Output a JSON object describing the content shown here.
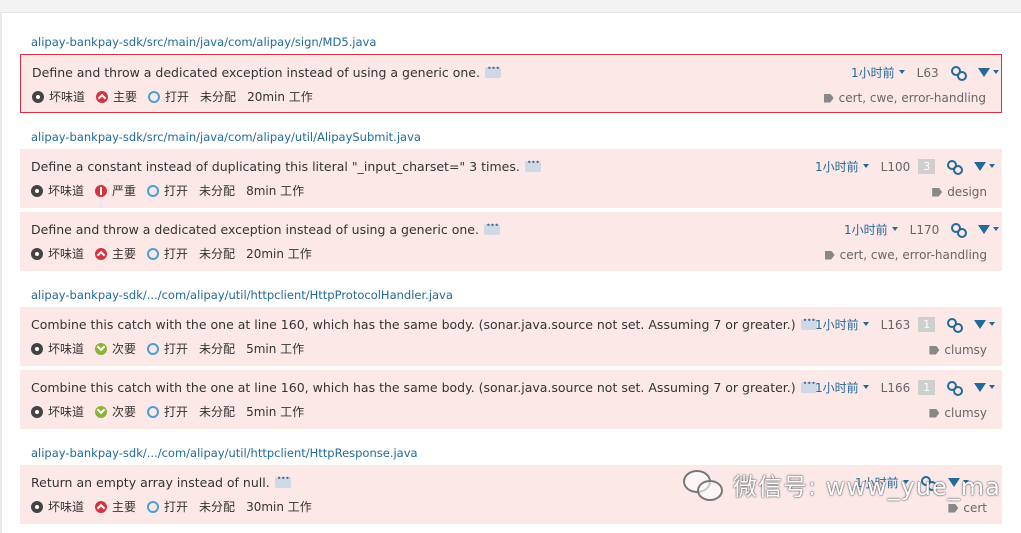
{
  "files": [
    "alipay-bankpay-sdk/src/main/java/com/alipay/sign/MD5.java",
    "alipay-bankpay-sdk/src/main/java/com/alipay/util/AlipaySubmit.java",
    "alipay-bankpay-sdk/.../com/alipay/util/httpclient/HttpProtocolHandler.java",
    "alipay-bankpay-sdk/.../com/alipay/util/httpclient/HttpResponse.java"
  ],
  "issues": [
    {
      "message": "Define and throw a dedicated exception instead of using a generic one.",
      "type": "坏味道",
      "severity": "主要",
      "status": "打开",
      "assignee": "未分配",
      "effort": "20min 工作",
      "time": "1小时前",
      "line": "L63",
      "count": "",
      "tags": "cert, cwe, error-handling"
    },
    {
      "message": "Define a constant instead of duplicating this literal \"_input_charset=\" 3 times.",
      "type": "坏味道",
      "severity": "严重",
      "status": "打开",
      "assignee": "未分配",
      "effort": "8min 工作",
      "time": "1小时前",
      "line": "L100",
      "count": "3",
      "tags": "design"
    },
    {
      "message": "Define and throw a dedicated exception instead of using a generic one.",
      "type": "坏味道",
      "severity": "主要",
      "status": "打开",
      "assignee": "未分配",
      "effort": "20min 工作",
      "time": "1小时前",
      "line": "L170",
      "count": "",
      "tags": "cert, cwe, error-handling"
    },
    {
      "message": "Combine this catch with the one at line 160, which has the same body. (sonar.java.source not set. Assuming 7 or greater.)",
      "type": "坏味道",
      "severity": "次要",
      "status": "打开",
      "assignee": "未分配",
      "effort": "5min 工作",
      "time": "1小时前",
      "line": "L163",
      "count": "1",
      "tags": "clumsy"
    },
    {
      "message": "Combine this catch with the one at line 160, which has the same body. (sonar.java.source not set. Assuming 7 or greater.)",
      "type": "坏味道",
      "severity": "次要",
      "status": "打开",
      "assignee": "未分配",
      "effort": "5min 工作",
      "time": "1小时前",
      "line": "L166",
      "count": "1",
      "tags": "clumsy"
    },
    {
      "message": "Return an empty array instead of null.",
      "type": "坏味道",
      "severity": "主要",
      "status": "打开",
      "assignee": "未分配",
      "effort": "30min 工作",
      "time": "1小时前",
      "line": "",
      "count": "",
      "tags": "cert"
    }
  ],
  "watermark": "微信号: www_yue_ma",
  "icons": {
    "type": "code-smell-icon",
    "major": "major-severity-icon",
    "critical": "critical-severity-icon",
    "minor": "minor-severity-icon",
    "open": "open-status-icon",
    "link": "permalink-icon",
    "filter": "filter-icon",
    "tag": "tag-icon"
  },
  "colors": {
    "issue_bg": "#fde8e8",
    "selected_border": "#d4333f",
    "link": "#236a97",
    "major": "#d4333f",
    "minor": "#8bb33a",
    "open": "#4b9fd5"
  }
}
